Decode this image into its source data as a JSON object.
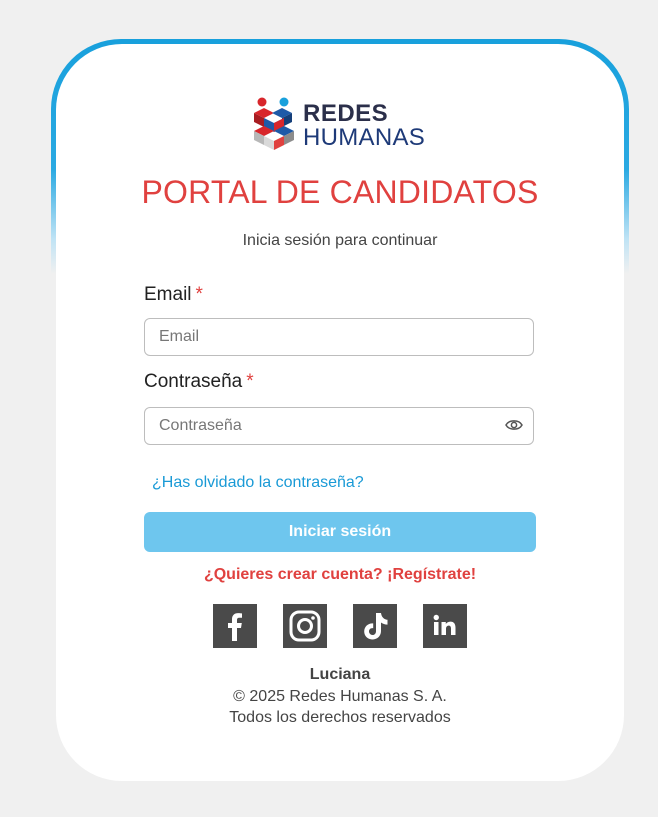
{
  "brand": {
    "line1": "REDES",
    "line2": "HUMANAS",
    "logo_icon": "redes-humanas-logo",
    "colors": {
      "red": "#d8262b",
      "blue": "#1e5aa8",
      "light_blue": "#18a0dc"
    }
  },
  "title": "PORTAL DE CANDIDATOS",
  "subtitle": "Inicia sesión para continuar",
  "form": {
    "email_label": "Email",
    "email_required": "*",
    "email_placeholder": "Email",
    "email_value": "",
    "password_label": "Contraseña",
    "password_required": "*",
    "password_placeholder": "Contraseña",
    "password_value": "",
    "show_password_icon": "eye-icon",
    "forgot_link": "¿Has olvidado la contraseña?",
    "submit_label": "Iniciar sesión",
    "register_link": "¿Quieres crear cuenta? ¡Regístrate!"
  },
  "social": [
    {
      "name": "facebook",
      "icon": "facebook-icon"
    },
    {
      "name": "instagram",
      "icon": "instagram-icon"
    },
    {
      "name": "tiktok",
      "icon": "tiktok-icon"
    },
    {
      "name": "linkedin",
      "icon": "linkedin-icon"
    }
  ],
  "footer": {
    "name": "Luciana",
    "copyright": "© 2025 Redes Humanas S. A.",
    "rights": "Todos los derechos reservados"
  },
  "colors": {
    "accent_red": "#e0413f",
    "link_blue": "#1a9ad6",
    "button_bg": "#6ec6ee"
  }
}
